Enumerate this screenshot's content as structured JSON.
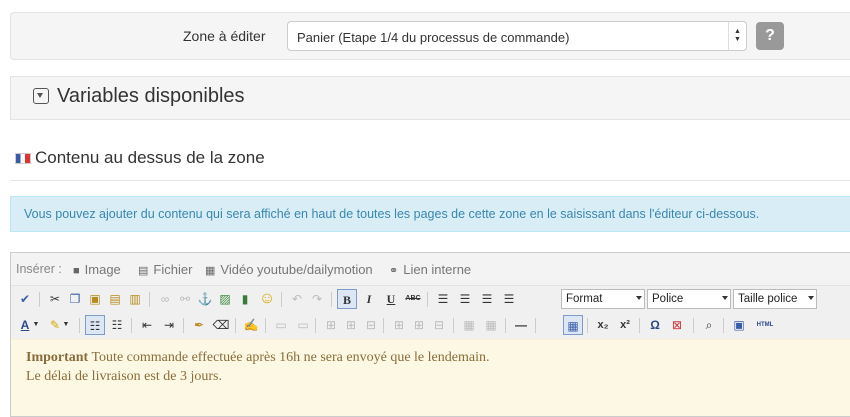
{
  "zone": {
    "label": "Zone à éditer",
    "selected": "Panier (Etape 1/4 du processus de commande)",
    "help_label": "?"
  },
  "variables": {
    "title": "Variables disponibles"
  },
  "section": {
    "title": "Contenu au dessus de la zone"
  },
  "info": {
    "text": "Vous pouvez ajouter du contenu qui sera affiché en haut de toutes les pages de cette zone en le saisissant dans l'éditeur ci-dessous."
  },
  "insert": {
    "label": "Insérer :",
    "items": [
      {
        "label": "Image",
        "icon": "camera-icon"
      },
      {
        "label": "Fichier",
        "icon": "file-icon"
      },
      {
        "label": "Vidéo youtube/dailymotion",
        "icon": "film-icon"
      },
      {
        "label": "Lien interne",
        "icon": "link-icon"
      }
    ]
  },
  "toolbar": {
    "format_label": "Format",
    "font_label": "Police",
    "size_label": "Taille police",
    "bold": "B",
    "italic": "I",
    "underline": "U",
    "strike": "ABC",
    "subscript": "x₂",
    "superscript": "x²",
    "omega": "Ω",
    "html": "HTML"
  },
  "content": {
    "strong": "Important",
    "line1": " Toute commande effectuée après 16h ne sera envoyé que le lendemain.",
    "line2": "Le délai de livraison est de 3 jours."
  }
}
